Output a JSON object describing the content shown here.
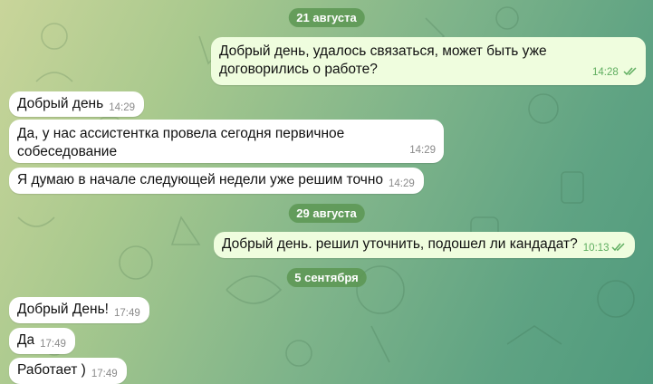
{
  "chat": {
    "dates": [
      "21 августа",
      "29 августа",
      "5 сентября"
    ],
    "messages": [
      {
        "text": "Добрый день, удалось связаться, может быть уже\nдоговорились о работе?",
        "time": "14:28"
      },
      {
        "text": "Добрый день",
        "time": "14:29"
      },
      {
        "text": "Да, у нас ассистентка провела сегодня первичное\nсобеседование",
        "time": "14:29"
      },
      {
        "text": "Я думаю в начале следующей недели уже решим точно",
        "time": "14:29"
      },
      {
        "text": "Добрый день. решил уточнить, подошел ли кандадат?",
        "time": "10:13"
      },
      {
        "text": "Добрый День!",
        "time": "17:49"
      },
      {
        "text": "Да",
        "time": "17:49"
      },
      {
        "text": "Работает )",
        "time": "17:49"
      }
    ]
  },
  "colors": {
    "outgoing_bubble": "#effdde",
    "incoming_bubble": "#ffffff",
    "date_pill": "#5c9652",
    "read_check": "#5fae60"
  },
  "icons": {
    "read_status": "double-check-icon"
  }
}
